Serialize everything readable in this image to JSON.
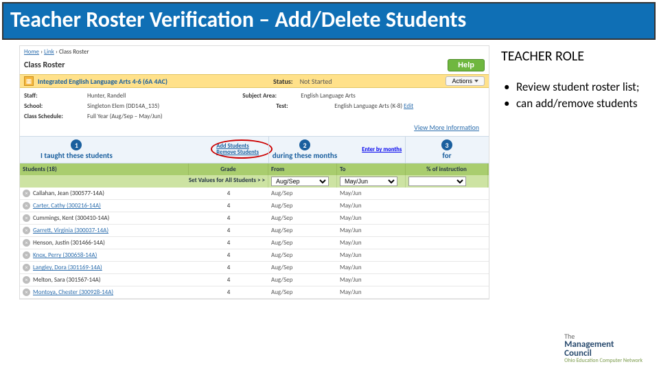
{
  "slide": {
    "title": "Teacher Roster Verification – Add/Delete Students",
    "role_heading": "TEACHER ROLE",
    "bullets": [
      "Review student roster list;",
      "can add/remove students"
    ]
  },
  "breadcrumbs": {
    "home": "Home",
    "link": "Link",
    "current": "Class Roster"
  },
  "header": {
    "title": "Class Roster",
    "help": "Help"
  },
  "yellow": {
    "title": "Integrated English Language Arts 4-6 (6A 4AC)",
    "status_label": "Status:",
    "status_value": "Not Started",
    "actions": "Actions"
  },
  "meta": {
    "staff_l": "Staff:",
    "staff_v": "Hunter, Randell",
    "school_l": "School:",
    "school_v": "Singleton Elem (DD14A_135)",
    "sched_l": "Class Schedule:",
    "sched_v": "Full Year (Aug/Sep – May/Jun)",
    "subj_l": "Subject Area:",
    "subj_v": "English Language Arts",
    "test_l": "Test:",
    "test_v": "English Language Arts (K-8)",
    "edit": "Edit",
    "vmi": "View More Information"
  },
  "steps": {
    "s1": {
      "num": "1",
      "text": "I taught these students",
      "add": "Add Students",
      "remove": "Remove Students"
    },
    "s2": {
      "num": "2",
      "text": "during these months",
      "enter": "Enter by months"
    },
    "s3": {
      "num": "3",
      "text": "for"
    }
  },
  "columns": {
    "students": "Students (18)",
    "grade": "Grade",
    "from": "From",
    "to": "To",
    "pct": "% of instruction"
  },
  "setrow": {
    "label": "Set Values for All Students > >",
    "from": "Aug/Sep",
    "to": "May/Jun"
  },
  "rows": [
    {
      "name": "Callahan, Jean (300577-14A)",
      "link": false,
      "grade": "4",
      "from": "Aug/Sep",
      "to": "May/Jun"
    },
    {
      "name": "Carter, Cathy (300216-14A)",
      "link": true,
      "grade": "4",
      "from": "Aug/Sep",
      "to": "May/Jun"
    },
    {
      "name": "Cummings, Kent (300410-14A)",
      "link": false,
      "grade": "4",
      "from": "Aug/Sep",
      "to": "May/Jun"
    },
    {
      "name": "Garrett, Virginia (300037-14A)",
      "link": true,
      "grade": "4",
      "from": "Aug/Sep",
      "to": "May/Jun"
    },
    {
      "name": "Henson, Justin (301466-14A)",
      "link": false,
      "grade": "4",
      "from": "Aug/Sep",
      "to": "May/Jun"
    },
    {
      "name": "Knox, Perry (300658-14A)",
      "link": true,
      "grade": "4",
      "from": "Aug/Sep",
      "to": "May/Jun"
    },
    {
      "name": "Langley, Dora (301169-14A)",
      "link": true,
      "grade": "4",
      "from": "Aug/Sep",
      "to": "May/Jun"
    },
    {
      "name": "Melton, Sara (301567-14A)",
      "link": false,
      "grade": "4",
      "from": "Aug/Sep",
      "to": "May/Jun"
    },
    {
      "name": "Montoya, Chester (300928-14A)",
      "link": true,
      "grade": "4",
      "from": "Aug/Sep",
      "to": "May/Jun"
    }
  ],
  "logo": {
    "line1": "The",
    "line2": "Management",
    "line3": "Council",
    "sub": "Ohio Education Computer Network"
  }
}
